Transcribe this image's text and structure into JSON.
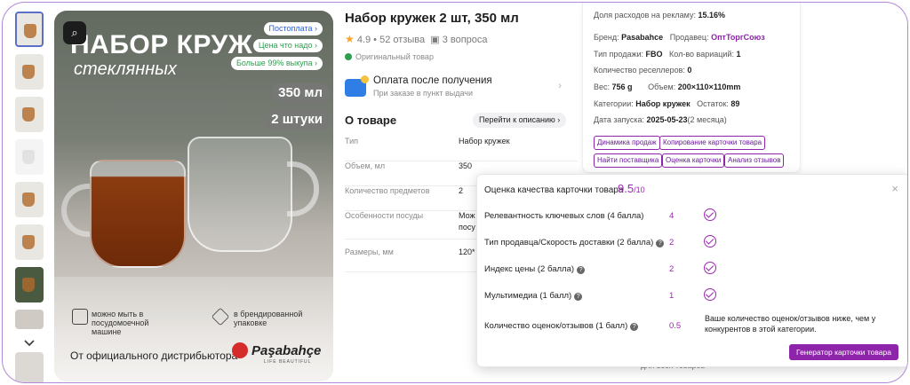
{
  "gallery": {
    "title_line1": "НАБОР КРУЖ",
    "title_line2": "стеклянных",
    "tags": [
      "Постоплата",
      "Цена что надо",
      "Больше 99% выкупа"
    ],
    "volume_chip": "350 мл",
    "quantity_chip": "2 штуки",
    "feature1": "можно мыть в посудомоечной машине",
    "feature2": "в брендированной упаковке",
    "distributor": "От официального дистрибьютора",
    "brand_name": "Paşabahçe",
    "brand_sub": "LIFE BEAUTIFUL"
  },
  "product": {
    "title": "Набор кружек 2 шт, 350 мл",
    "rating": "4.9",
    "reviews": "52 отзыва",
    "questions": "3 вопроса",
    "original": "Оригинальный товар",
    "payment_title": "Оплата после получения",
    "payment_sub": "При заказе в пункт выдачи",
    "about_heading": "О товаре",
    "goto_description": "Перейти к описанию",
    "specs": [
      {
        "key": "Тип",
        "value": "Набор кружек"
      },
      {
        "key": "Объем, мл",
        "value": "350"
      },
      {
        "key": "Количество предметов",
        "value": "2"
      },
      {
        "key": "Особенности посуды",
        "value": "Мож"
      },
      {
        "key": "",
        "value": "посу"
      },
      {
        "key": "Размеры, мм",
        "value": "120*"
      }
    ]
  },
  "panel": {
    "ad_share_label": "Доля расходов на рекламу:",
    "ad_share_value": "15.16%",
    "brand_label": "Бренд:",
    "brand_value": "Pasabahce",
    "seller_label": "Продавец:",
    "seller_value": "ОптТоргСоюз",
    "sale_type_label": "Тип продажи:",
    "sale_type_value": "FBO",
    "variations_label": "Кол-во вариаций:",
    "variations_value": "1",
    "resellers_label": "Количество реселлеров:",
    "resellers_value": "0",
    "weight_label": "Вес:",
    "weight_value": "756 g",
    "volume_label": "Объем:",
    "volume_value": "200×110×110mm",
    "category_label": "Категории:",
    "category_value": "Набор кружек",
    "stock_label": "Остаток:",
    "stock_value": "89",
    "launch_label": "Дата запуска:",
    "launch_value": "2025-05-23",
    "launch_extra": "(2 месяца)",
    "buttons": [
      "Динамика продаж",
      "Копирование карточки товара",
      "Найти поставщика",
      "Оценка карточки",
      "Анализ отзывов"
    ],
    "footer": "для всех товаров"
  },
  "quality": {
    "title": "Оценка качества карточки товара",
    "score": "9.5",
    "score_max": "/10",
    "close": "×",
    "criteria": [
      {
        "label": "Релевантность ключевых слов (4 балла)",
        "value": "4"
      },
      {
        "label": "Тип продавца/Скорость доставки (2 балла)",
        "value": "2"
      },
      {
        "label": "Индекс цены (2 балла)",
        "value": "2"
      },
      {
        "label": "Мультимедиа (1 балл)",
        "value": "1"
      },
      {
        "label": "Количество оценок/отзывов (1 балл)",
        "value": "0.5"
      }
    ],
    "note": "Ваше количество оценок/отзывов ниже, чем у конкурентов в этой категории.",
    "generator_button": "Генератор карточки товара"
  },
  "colors": {
    "accent": "#8e24aa",
    "frame_border": "#b487d8",
    "tag_blue": "#2c5fd6",
    "tag_green": "#2e9e4f"
  }
}
